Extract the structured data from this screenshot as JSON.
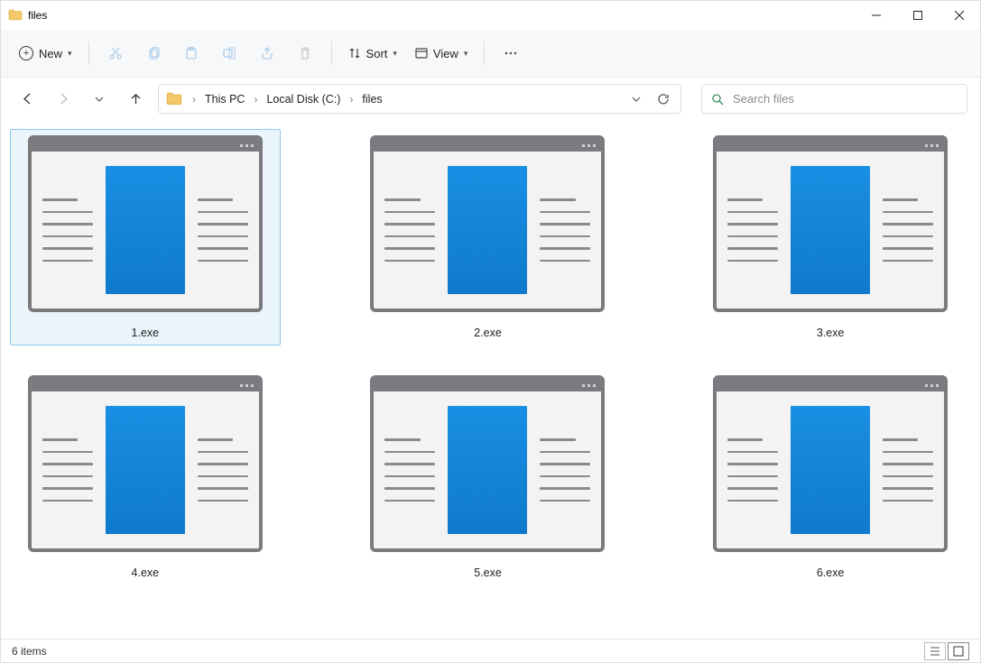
{
  "window": {
    "title": "files"
  },
  "toolbar": {
    "new_label": "New",
    "sort_label": "Sort",
    "view_label": "View"
  },
  "breadcrumbs": {
    "items": [
      "This PC",
      "Local Disk (C:)",
      "files"
    ]
  },
  "search": {
    "placeholder": "Search files"
  },
  "files": {
    "items": [
      {
        "name": "1.exe",
        "selected": true
      },
      {
        "name": "2.exe",
        "selected": false
      },
      {
        "name": "3.exe",
        "selected": false
      },
      {
        "name": "4.exe",
        "selected": false
      },
      {
        "name": "5.exe",
        "selected": false
      },
      {
        "name": "6.exe",
        "selected": false
      }
    ]
  },
  "status": {
    "text": "6 items"
  }
}
